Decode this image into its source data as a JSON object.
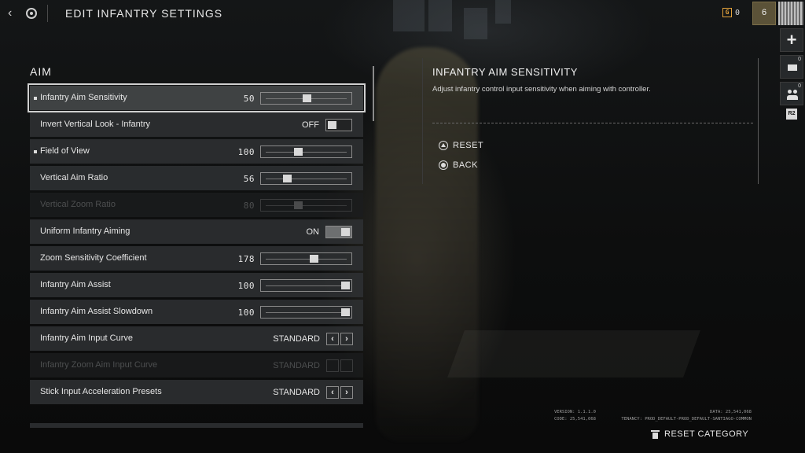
{
  "header": {
    "title": "EDIT INFANTRY SETTINGS",
    "currency_count": "0",
    "currency_symbol": "G",
    "rank": "6"
  },
  "dock": {
    "mail_count": "0",
    "group_count": "0",
    "shoulder_label": "R2"
  },
  "section": {
    "title": "AIM"
  },
  "settings": [
    {
      "label": "Infantry Aim Sensitivity",
      "type": "slider",
      "value": "50",
      "fill": 0.5,
      "selected": true,
      "changed": true
    },
    {
      "label": "Invert Vertical Look - Infantry",
      "type": "toggle",
      "value": "OFF"
    },
    {
      "label": "Field of View",
      "type": "slider",
      "value": "100",
      "fill": 0.4,
      "changed": true
    },
    {
      "label": "Vertical Aim Ratio",
      "type": "slider",
      "value": "56",
      "fill": 0.26
    },
    {
      "label": "Vertical Zoom Ratio",
      "type": "slider",
      "value": "80",
      "fill": 0.4,
      "disabled": true
    },
    {
      "label": "Uniform Infantry Aiming",
      "type": "toggle",
      "value": "ON"
    },
    {
      "label": "Zoom Sensitivity Coefficient",
      "type": "slider",
      "value": "178",
      "fill": 0.59
    },
    {
      "label": "Infantry Aim Assist",
      "type": "slider",
      "value": "100",
      "fill": 1.0
    },
    {
      "label": "Infantry Aim Assist Slowdown",
      "type": "slider",
      "value": "100",
      "fill": 1.0
    },
    {
      "label": "Infantry Aim Input Curve",
      "type": "select",
      "value": "STANDARD"
    },
    {
      "label": "Infantry Zoom Aim Input Curve",
      "type": "select",
      "value": "STANDARD",
      "disabled": true
    },
    {
      "label": "Stick Input Acceleration Presets",
      "type": "select",
      "value": "STANDARD"
    }
  ],
  "info": {
    "title": "INFANTRY AIM SENSITIVITY",
    "description": "Adjust infantry control input sensitivity when aiming with controller.",
    "reset_label": "RESET",
    "back_label": "BACK"
  },
  "footer": {
    "version_label": "VERSION: 1.1.1.0",
    "code_label": "CODE: 25,541,068",
    "data_label": "DATA: 25,541,068",
    "tenancy_label": "TENANCY: PROD_DEFAULT-PROD_DEFAULT-SANTIAGO-COMMON",
    "reset_category_label": "RESET CATEGORY"
  },
  "colors": {
    "accent_currency": "#e3a23b",
    "panel_row": "#2e3032",
    "text": "#e6e6e6"
  }
}
